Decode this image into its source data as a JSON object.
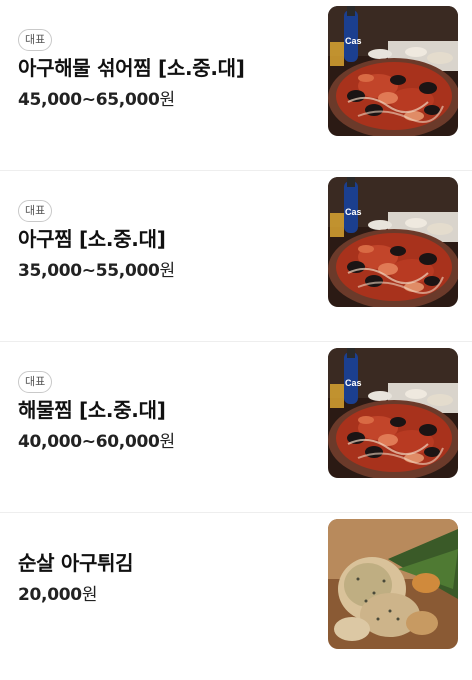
{
  "menu": {
    "items": [
      {
        "badge": "대표",
        "name": "아구해물 섞어찜 [소.중.대]",
        "price": "45,000~65,000",
        "unit": "원",
        "image": "seafood-stew-photo"
      },
      {
        "badge": "대표",
        "name": "아구찜 [소.중.대]",
        "price": "35,000~55,000",
        "unit": "원",
        "image": "seafood-stew-photo"
      },
      {
        "badge": "대표",
        "name": "해물찜 [소.중.대]",
        "price": "40,000~60,000",
        "unit": "원",
        "image": "seafood-stew-photo"
      },
      {
        "name": "순살 아구튀김",
        "price": "20,000",
        "unit": "원",
        "image": "fried-fish-photo"
      }
    ]
  },
  "colors": {
    "divider": "#eeeeee",
    "badge_border": "#c9c9c9",
    "text": "#111111"
  }
}
